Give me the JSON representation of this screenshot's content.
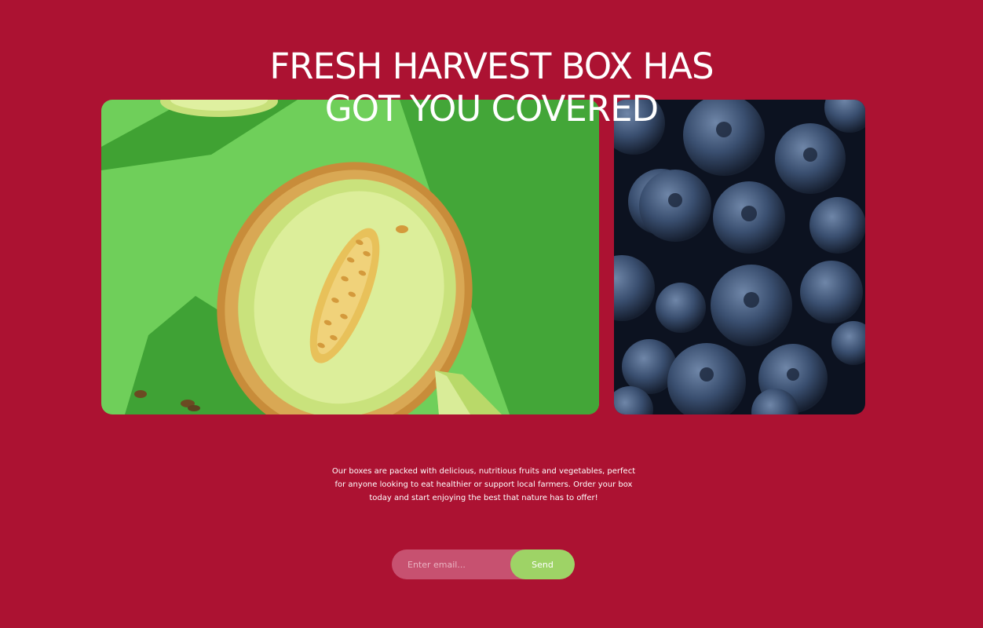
{
  "hero": {
    "headline_line1": "FRESH HARVEST BOX HAS",
    "headline_line2": "GOT YOU COVERED"
  },
  "gallery": {
    "items": [
      {
        "subject": "halved melon on green background"
      },
      {
        "subject": "blueberries close-up"
      }
    ]
  },
  "description": "Our boxes are packed with delicious, nutritious fruits and vegetables, perfect for anyone looking to eat healthier or support local farmers. Order your box today and start enjoying the best that nature has to offer!",
  "signup": {
    "email_placeholder": "Enter email...",
    "send_label": "Send"
  },
  "colors": {
    "background": "#ac1232",
    "input_bg": "#c75170",
    "button_bg": "#9ed366",
    "text": "#ffffff"
  }
}
